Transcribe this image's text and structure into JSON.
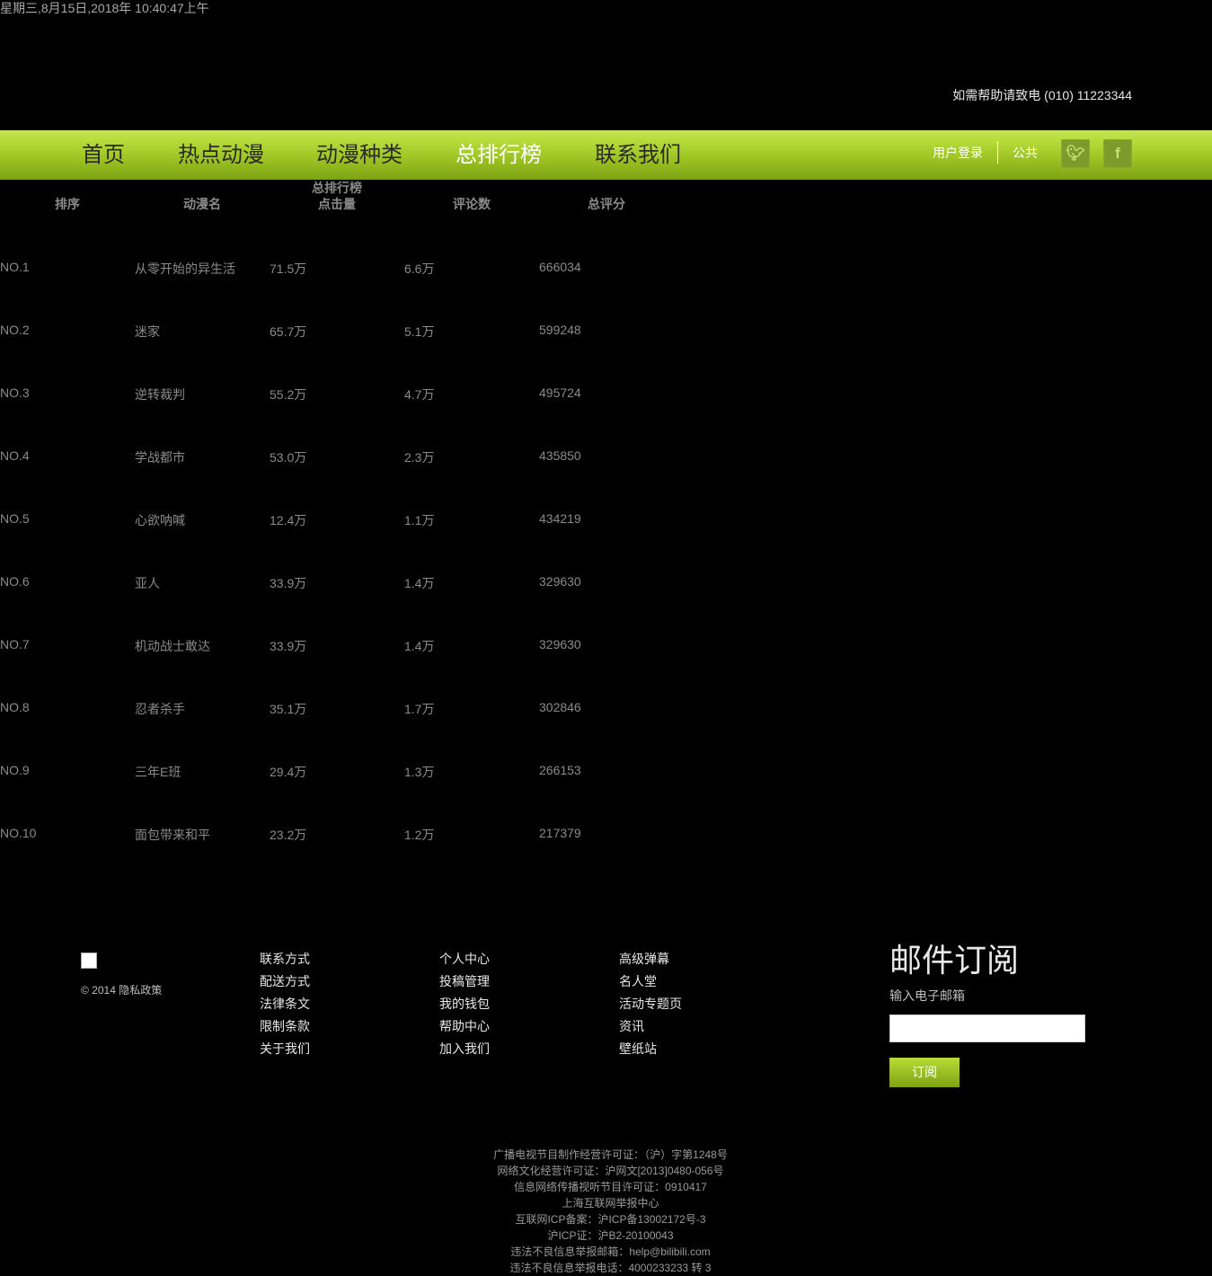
{
  "header": {
    "datetime": "星期三,8月15日,2018年 10:40:47上午",
    "help": "如需帮助请致电 (010) 11223344"
  },
  "nav": {
    "items": [
      "首页",
      "热点动漫",
      "动漫种类",
      "总排行榜",
      "联系我们"
    ],
    "active": "总排行榜",
    "login": "用户登录",
    "public": "公共",
    "twitter_icon": "twitter-icon",
    "facebook_icon": "facebook-icon"
  },
  "ranking": {
    "header_line1": "总排行榜",
    "headers": [
      "排序",
      "动漫名",
      "点击量",
      "评论数",
      "总评分"
    ],
    "rows": [
      [
        "NO.1",
        "从零开始的异生活",
        "71.5万",
        "6.6万",
        "666034"
      ],
      [
        "NO.2",
        "迷家",
        "65.7万",
        "5.1万",
        "599248"
      ],
      [
        "NO.3",
        "逆转裁判",
        "55.2万",
        "4.7万",
        "495724"
      ],
      [
        "NO.4",
        "学战都市",
        "53.0万",
        "2.3万",
        "435850"
      ],
      [
        "NO.5",
        "心欲呐喊",
        "12.4万",
        "1.1万",
        "434219"
      ],
      [
        "NO.6",
        "亚人",
        "33.9万",
        "1.4万",
        "329630"
      ],
      [
        "NO.7",
        "机动战士敢达",
        "33.9万",
        "1.4万",
        "329630"
      ],
      [
        "NO.8",
        "忍者杀手",
        "35.1万",
        "1.7万",
        "302846"
      ],
      [
        "NO.9",
        "三年E班",
        "29.4万",
        "1.3万",
        "266153"
      ],
      [
        "NO.10",
        "面包带来和平",
        "23.2万",
        "1.2万",
        "217379"
      ]
    ]
  },
  "footer": {
    "copyright": "© 2014 隐私政策",
    "columns": [
      [
        "联系方式",
        "配送方式",
        "法律条文",
        "限制条款",
        "关于我们"
      ],
      [
        "个人中心",
        "投稿管理",
        "我的钱包",
        "帮助中心",
        "加入我们"
      ],
      [
        "高级弹幕",
        "名人堂",
        "活动专题页",
        "资讯",
        "壁纸站"
      ]
    ],
    "subscribe": {
      "title": "邮件订阅",
      "label": "输入电子邮箱",
      "input_value": "",
      "button": "订阅"
    },
    "legal": [
      "广播电视节目制作经营许可证：（沪）字第1248号",
      "网络文化经营许可证：沪网文[2013]0480-056号",
      "信息网络传播视听节目许可证：0910417",
      "上海互联网举报中心",
      "互联网ICP备案：沪ICP备13002172号-3",
      "沪ICP证：沪B2-20100043",
      "违法不良信息举报邮箱：help@bilibili.com",
      "违法不良信息举报电话：4000233233 转 3"
    ]
  }
}
